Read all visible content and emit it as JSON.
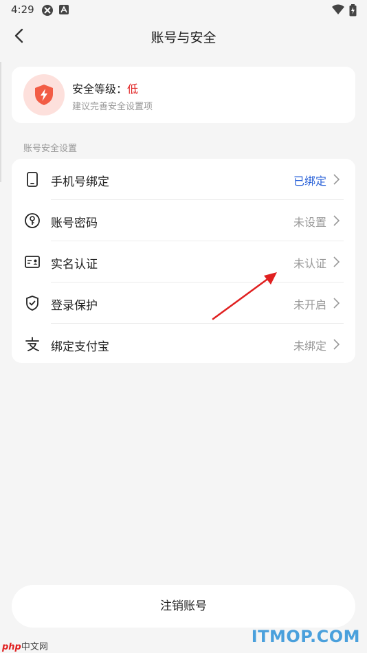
{
  "status_bar": {
    "time": "4:29"
  },
  "nav": {
    "title": "账号与安全"
  },
  "security": {
    "title_prefix": "安全等级：",
    "level": "低",
    "subtitle": "建议完善安全设置项"
  },
  "section_label": "账号安全设置",
  "items": [
    {
      "label": "手机号绑定",
      "status": "已绑定",
      "icon": "phone-icon"
    },
    {
      "label": "账号密码",
      "status": "未设置",
      "icon": "key-icon"
    },
    {
      "label": "实名认证",
      "status": "未认证",
      "icon": "id-card-icon"
    },
    {
      "label": "登录保护",
      "status": "未开启",
      "icon": "shield-check-icon"
    },
    {
      "label": "绑定支付宝",
      "status": "未绑定",
      "icon": "alipay-icon"
    }
  ],
  "logout_label": "注销账号",
  "watermarks": {
    "php_brand": "php",
    "php_text": "中文网",
    "site": "ITMOP.COM"
  },
  "colors": {
    "accent_red": "#e02020",
    "bound_blue": "#2a62d8",
    "badge_bg": "#fde0dc"
  }
}
